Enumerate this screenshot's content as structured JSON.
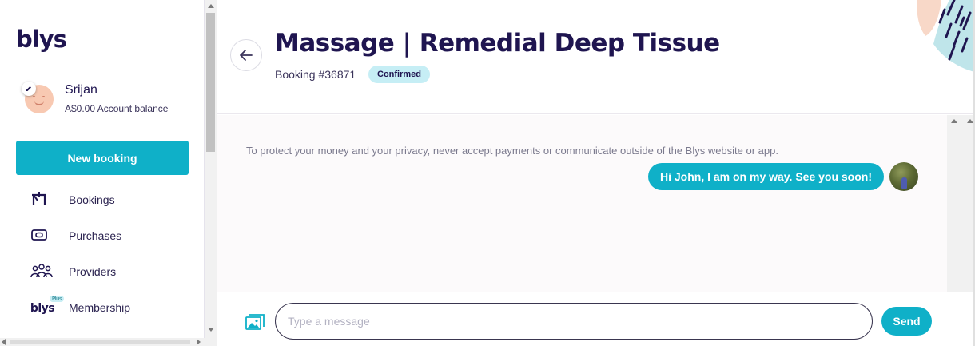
{
  "brand": {
    "logo_text": "blys",
    "accent": "#0fb0c8",
    "navy": "#1f1550"
  },
  "profile": {
    "name": "Srijan",
    "balance": "A$0.00 Account balance"
  },
  "sidebar": {
    "new_booking_label": "New booking",
    "items": [
      {
        "label": "Bookings",
        "icon": "bookings-icon"
      },
      {
        "label": "Purchases",
        "icon": "purchases-icon"
      },
      {
        "label": "Providers",
        "icon": "providers-icon"
      },
      {
        "label": "Membership",
        "icon": "blys-plus-icon",
        "icon_text": "blys",
        "icon_tag": "Plus"
      }
    ]
  },
  "booking": {
    "title": "Massage | Remedial Deep Tissue",
    "number": "Booking #36871",
    "status": "Confirmed"
  },
  "chat": {
    "notice": "To protect your money and your privacy, never accept payments or communicate outside of the Blys website or app.",
    "messages": [
      {
        "text": "Hi John, I am on my way. See you soon!"
      }
    ]
  },
  "composer": {
    "placeholder": "Type a message",
    "send_label": "Send"
  }
}
